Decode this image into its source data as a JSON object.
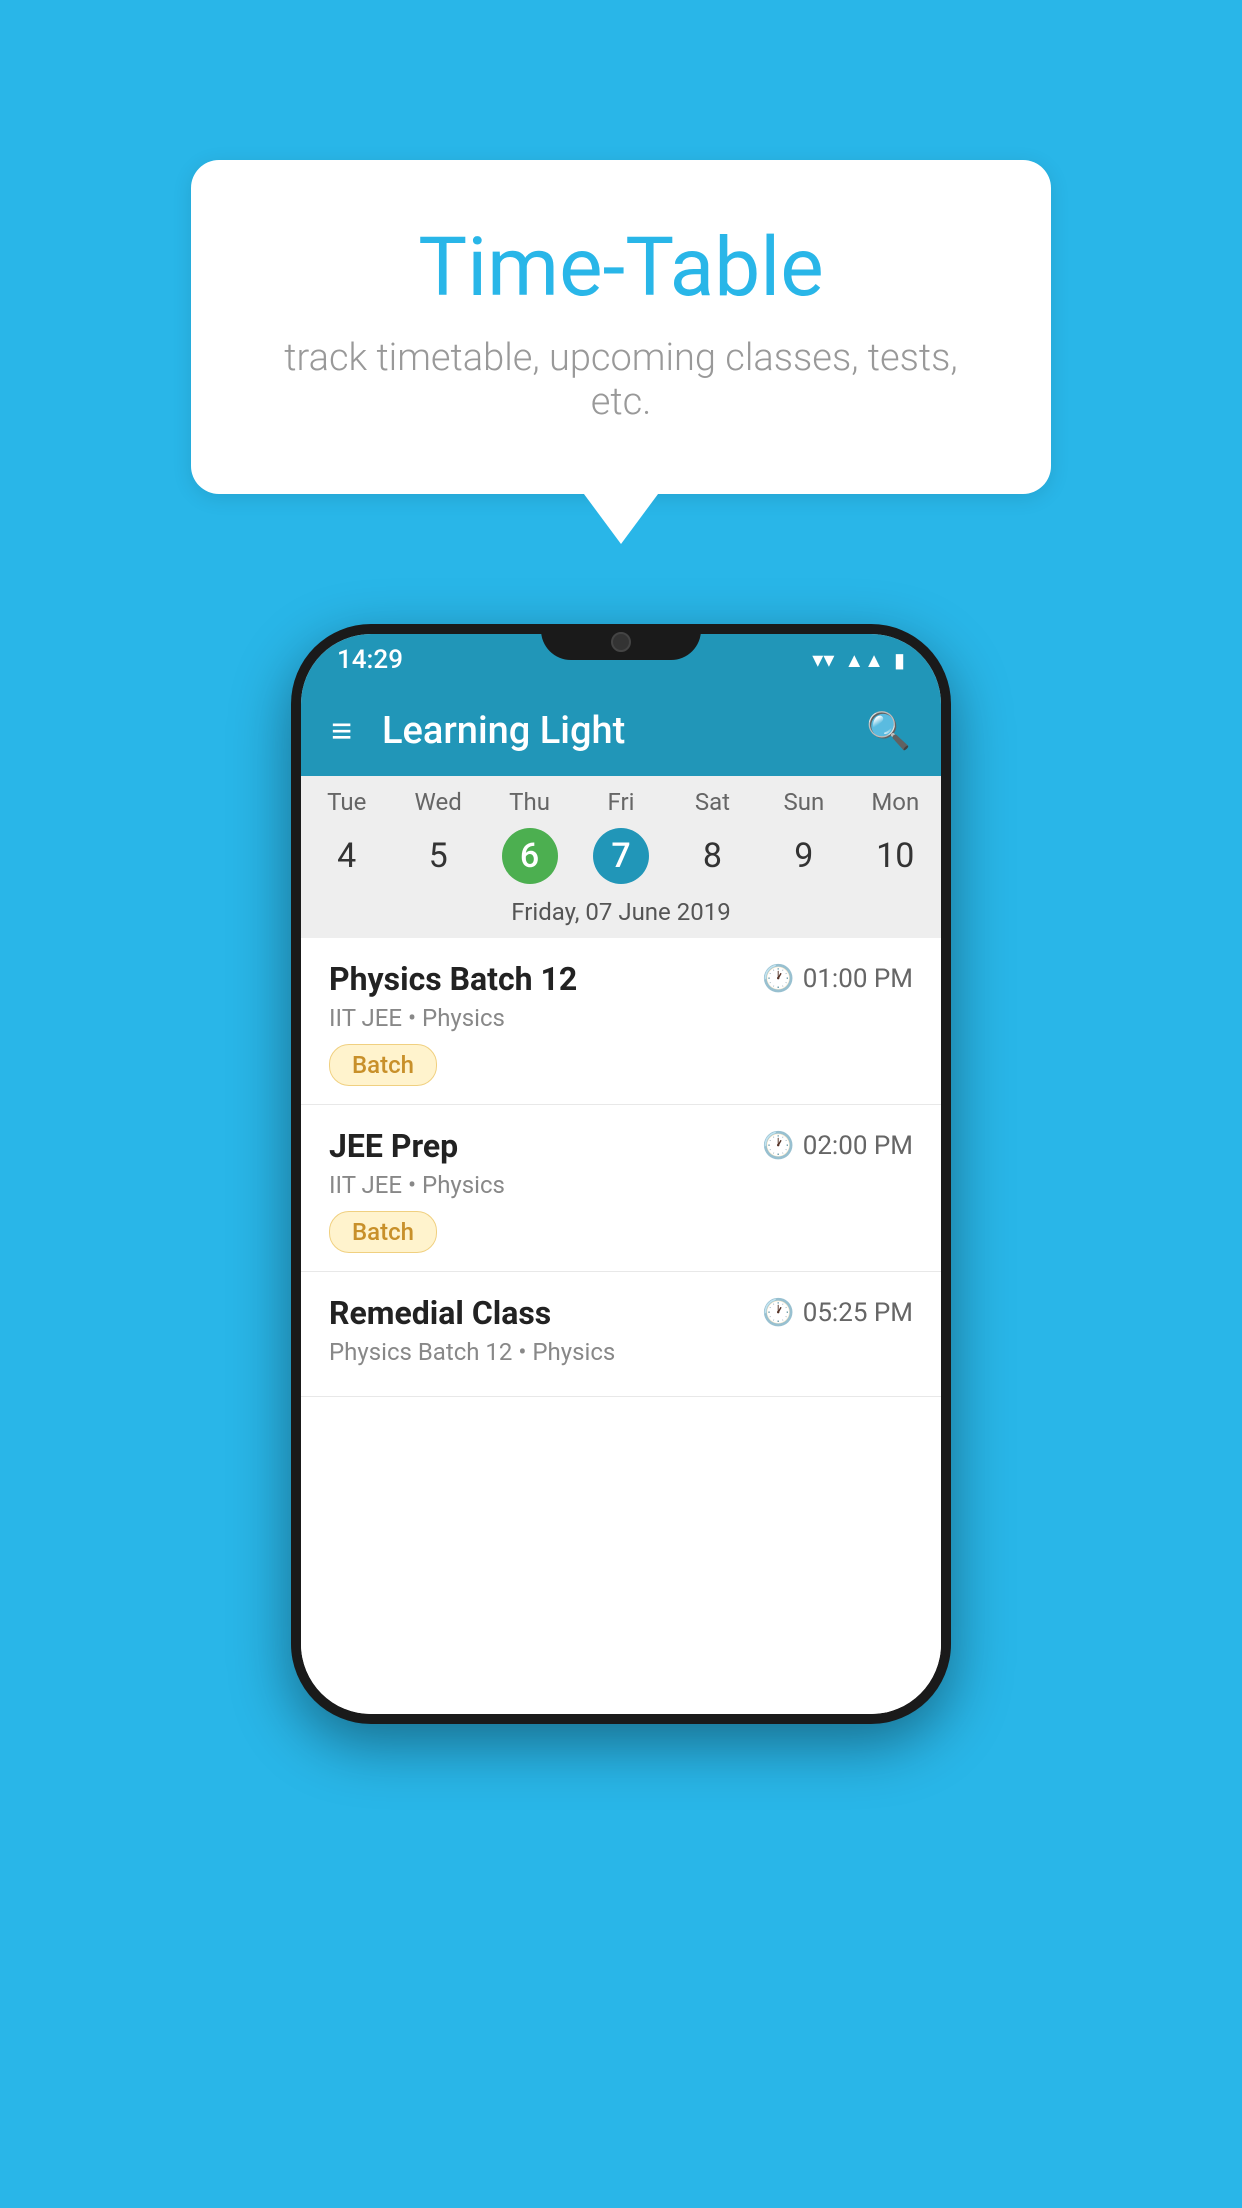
{
  "background_color": "#29b6e8",
  "speech_bubble": {
    "title": "Time-Table",
    "subtitle": "track timetable, upcoming classes, tests, etc."
  },
  "phone": {
    "status_bar": {
      "time": "14:29",
      "icons": [
        "wifi",
        "signal",
        "battery"
      ]
    },
    "app_bar": {
      "title": "Learning Light",
      "hamburger_label": "≡",
      "search_label": "🔍"
    },
    "calendar": {
      "day_headers": [
        "Tue",
        "Wed",
        "Thu",
        "Fri",
        "Sat",
        "Sun",
        "Mon"
      ],
      "day_numbers": [
        "4",
        "5",
        "6",
        "7",
        "8",
        "9",
        "10"
      ],
      "today_index": 2,
      "selected_index": 3,
      "selected_date_label": "Friday, 07 June 2019"
    },
    "schedule": [
      {
        "title": "Physics Batch 12",
        "time": "01:00 PM",
        "subtitle": "IIT JEE • Physics",
        "badge": "Batch"
      },
      {
        "title": "JEE Prep",
        "time": "02:00 PM",
        "subtitle": "IIT JEE • Physics",
        "badge": "Batch"
      },
      {
        "title": "Remedial Class",
        "time": "05:25 PM",
        "subtitle": "Physics Batch 12 • Physics",
        "badge": null
      }
    ]
  }
}
